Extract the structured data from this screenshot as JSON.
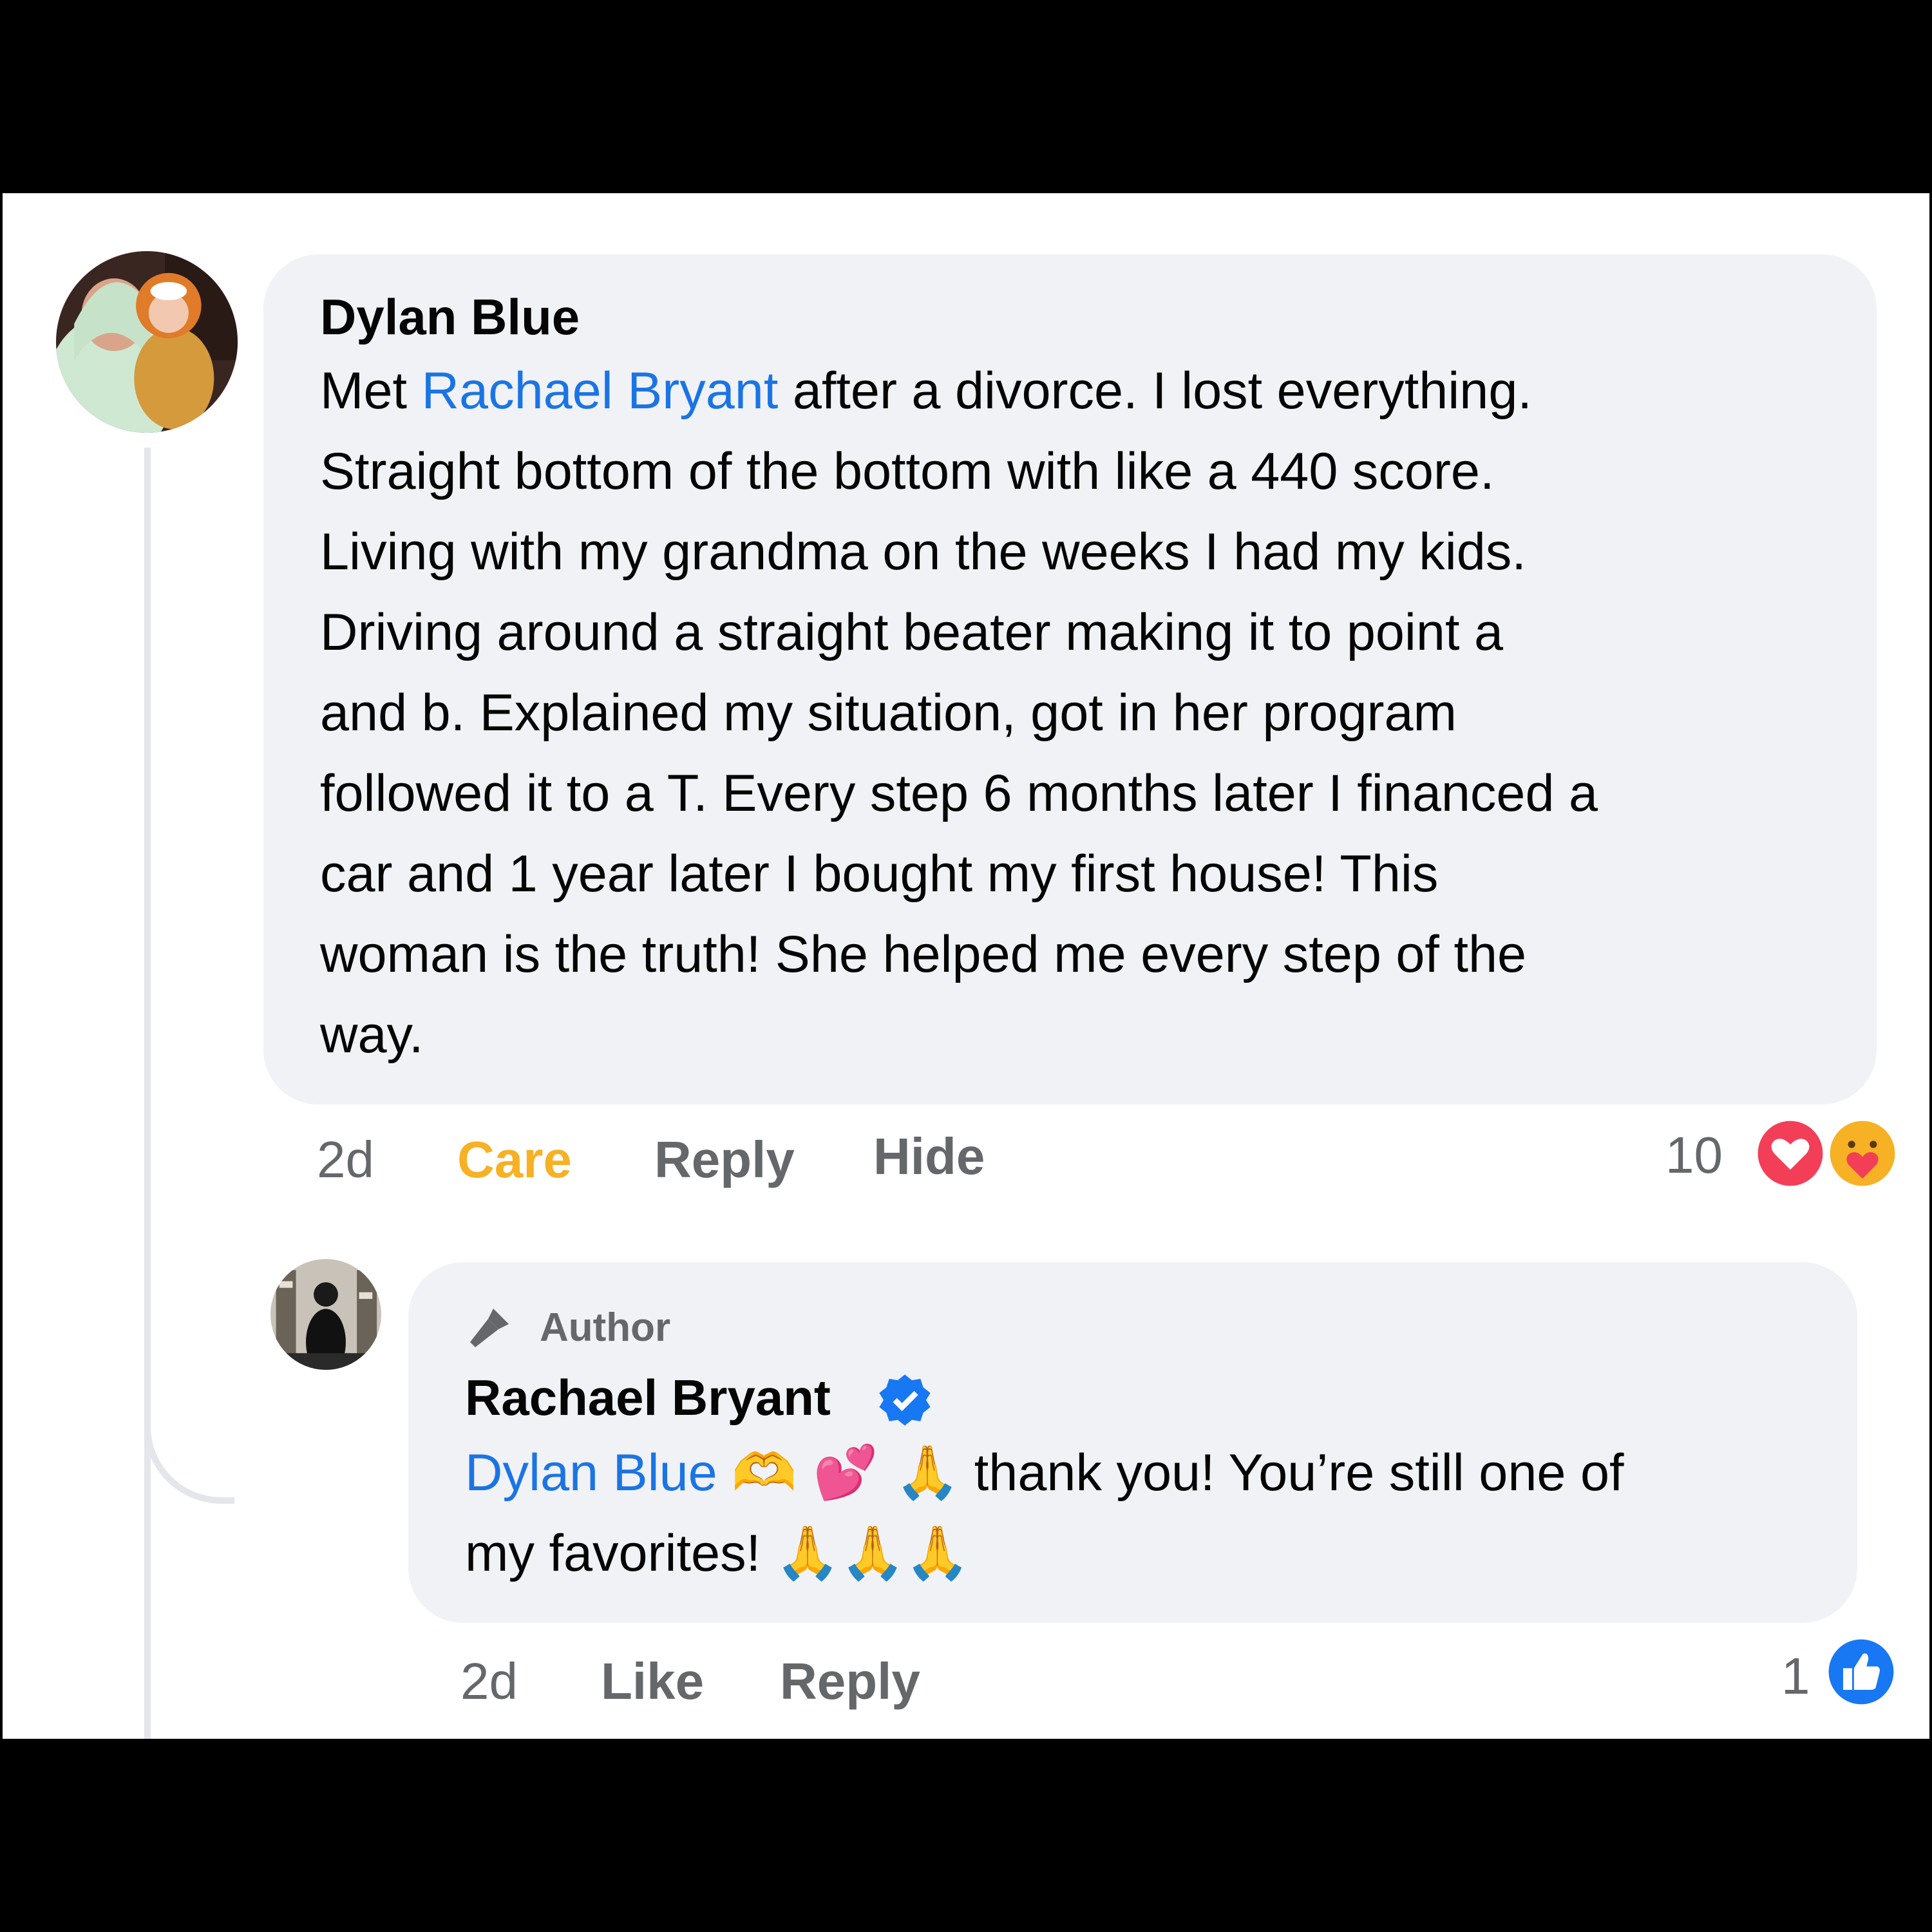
{
  "colors": {
    "link": "#1b74e4",
    "care": "#f7b125",
    "love": "#f33e58",
    "like": "#1877f2",
    "bubble": "#f0f2f5",
    "meta": "#65676b"
  },
  "comment": {
    "author": "Dylan Blue",
    "avatar_icon": "profile-photo",
    "text_before_mention": "Met ",
    "mention": "Rachael Bryant",
    "text_after_mention": " after a divorce. I lost everything.",
    "lines": [
      "Straight bottom of the bottom with like a 440 score.",
      "Living with my grandma on the weeks I had my kids.",
      "Driving around a straight beater making it to point a",
      "and b. Explained my situation, got in her program",
      "followed it to a T. Every step 6 months later I financed a",
      "car and 1 year later I bought my first house! This",
      "woman is the truth! She helped me every step of the",
      "way."
    ],
    "time": "2d",
    "reaction_label": "Care",
    "reply_label": "Reply",
    "hide_label": "Hide",
    "reaction_count": "10",
    "reaction_icons": [
      "love-reaction-icon",
      "care-reaction-icon"
    ]
  },
  "reply": {
    "badge_icon": "microphone-icon",
    "badge_label": "Author",
    "author": "Rachael Bryant",
    "verified_icon": "verified-badge-icon",
    "mention": "Dylan Blue",
    "line1_emoji": "🫶 💕 🙏",
    "line1_text": " thank you! You’re still one of",
    "line2_text": "my favorites! ",
    "line2_emoji": "🙏🙏🙏",
    "time": "2d",
    "like_label": "Like",
    "reply_label": "Reply",
    "reaction_count": "1",
    "reaction_icons": [
      "like-reaction-icon"
    ]
  }
}
